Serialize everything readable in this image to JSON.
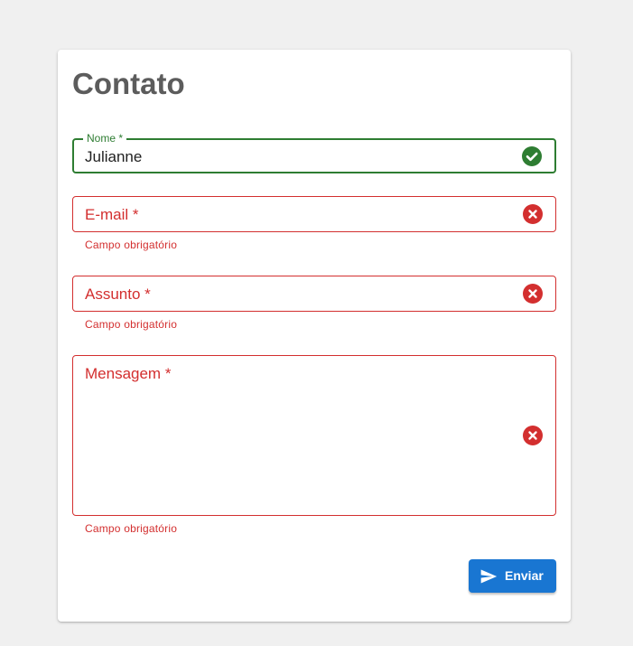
{
  "form": {
    "title": "Contato",
    "fields": {
      "nome": {
        "label": "Nome *",
        "value": "Julianne",
        "status_icon": "check-circle-icon"
      },
      "email": {
        "label": "E-mail *",
        "helper": "Campo obrigatório",
        "status_icon": "error-circle-icon"
      },
      "assunto": {
        "label": "Assunto *",
        "helper": "Campo obrigatório",
        "status_icon": "error-circle-icon"
      },
      "mensagem": {
        "label": "Mensagem *",
        "helper": "Campo obrigatório",
        "status_icon": "error-circle-icon"
      }
    },
    "submit": {
      "label": "Enviar",
      "icon": "send-icon"
    }
  },
  "colors": {
    "background": "#f0f0f0",
    "card": "#ffffff",
    "title": "#5c5c5c",
    "valid": "#2e7d32",
    "error": "#d32f2f",
    "primary": "#1976d2"
  }
}
